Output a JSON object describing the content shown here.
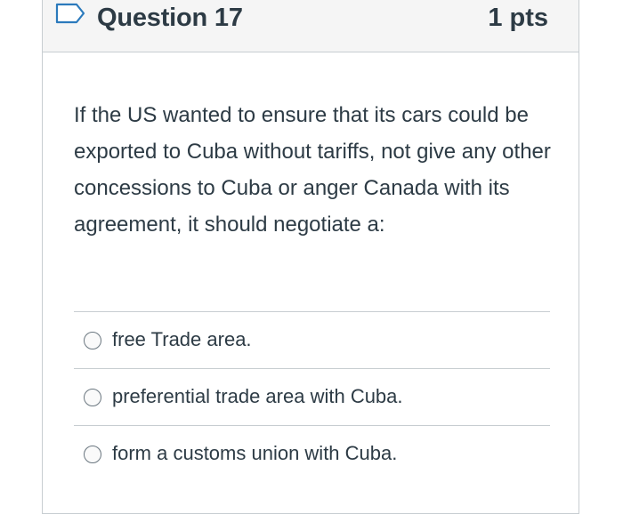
{
  "question": {
    "title": "Question 17",
    "points": "1 pts",
    "flag_icon": "flag-outline-icon",
    "text": "If the US wanted to ensure that its cars could be exported to Cuba without tariffs, not give any other concessions to Cuba or anger Canada with its agreement, it should negotiate a:"
  },
  "answers": [
    {
      "label": "free Trade area.",
      "selected": false
    },
    {
      "label": "preferential trade area with Cuba.",
      "selected": false
    },
    {
      "label": "form a customs union with Cuba.",
      "selected": false
    }
  ],
  "colors": {
    "header_bg": "#f5f5f5",
    "border": "#c7cdd1",
    "text": "#2d3b45",
    "flag_outline": "#2b7abc"
  }
}
